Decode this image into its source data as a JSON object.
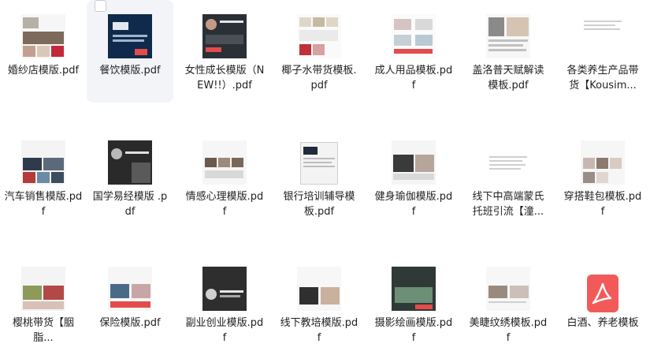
{
  "files": [
    {
      "name": "婚纱店模版.pdf"
    },
    {
      "name": "餐饮模版.pdf"
    },
    {
      "name": "女性成长模版（NEW!!）.pdf"
    },
    {
      "name": "椰子水带货模板.pdf"
    },
    {
      "name": "成人用品模板.pdf"
    },
    {
      "name": "盖洛普天赋解读模板.pdf"
    },
    {
      "name": "各类养生产品带货【Kousim..."
    },
    {
      "name": "汽车销售模版.pdf"
    },
    {
      "name": "国学易经模版 .pdf"
    },
    {
      "name": "情感心理模版.pdf"
    },
    {
      "name": "银行培训辅导模板.pdf"
    },
    {
      "name": "健身瑜伽模版.pdf"
    },
    {
      "name": "线下中高端蒙氏托班引流【潼..."
    },
    {
      "name": "穿搭鞋包模板.pdf"
    },
    {
      "name": "樱桃带货【胭脂..."
    },
    {
      "name": "保险模版.pdf"
    },
    {
      "name": "副业创业模版.pdf"
    },
    {
      "name": "线下教培模版.pdf"
    },
    {
      "name": "摄影绘画模版.pdf"
    },
    {
      "name": "美睫纹绣模板.pdf"
    },
    {
      "name": "白酒、养老模板"
    }
  ],
  "colors": {
    "accent": "#f25a5a",
    "selected_bg": "#f2f4f8",
    "text": "#1f1f1f"
  },
  "icons": {
    "pdf": "pdf-acrobat-icon"
  }
}
